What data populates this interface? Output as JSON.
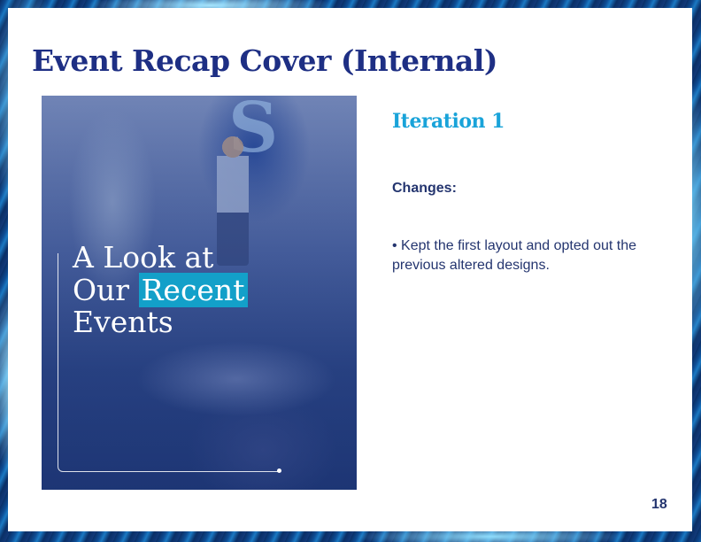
{
  "slide": {
    "title": "Event Recap Cover (Internal)",
    "page_number": "18"
  },
  "cover": {
    "line1": "A Look at",
    "line2_prefix": "Our ",
    "line2_highlight": "Recent",
    "line3": "Events",
    "logo_letter": "S"
  },
  "details": {
    "iteration": "Iteration 1",
    "changes_label": "Changes:",
    "bullet": "• Kept the first layout and opted out the previous altered designs."
  },
  "colors": {
    "title": "#1e2f84",
    "accent": "#19a3d9",
    "highlight": "#13a0c9",
    "body_text": "#24356f"
  }
}
